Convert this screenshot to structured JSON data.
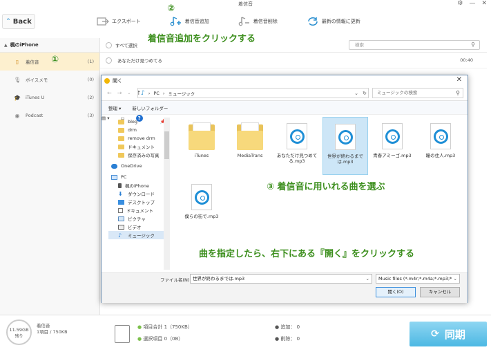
{
  "window": {
    "title": "着信音",
    "controls": [
      "⚙",
      "—",
      "✕"
    ]
  },
  "back_button": {
    "label": "Back"
  },
  "toolbar": {
    "export": "エクスポート",
    "add_ringtone": "着信音追加",
    "delete_ringtone": "着信音削除",
    "refresh": "最新の情報に更新"
  },
  "sidebar": {
    "device": "楓のiPhone",
    "items": [
      {
        "label": "着信音",
        "count": "(1)"
      },
      {
        "label": "ボイスメモ",
        "count": "(0)"
      },
      {
        "label": "iTunes U",
        "count": "(2)"
      },
      {
        "label": "Podcast",
        "count": "(3)"
      }
    ]
  },
  "list": {
    "select_all": "すべて選択",
    "search_placeholder": "検索",
    "rows": [
      {
        "title": "あなただけ見つめてる",
        "duration": "00:40"
      }
    ]
  },
  "dialog": {
    "title": "開く",
    "address": {
      "pc": "PC",
      "folder": "ミュージック"
    },
    "search_placeholder": "ミュージックの検索",
    "organize": "整理 ▾",
    "new_folder": "新しいフォルダー",
    "nav_items": [
      {
        "label": "blog",
        "icon": "folder"
      },
      {
        "label": "drm",
        "icon": "folder"
      },
      {
        "label": "remove drm",
        "icon": "folder"
      },
      {
        "label": "ドキュメント",
        "icon": "folder"
      },
      {
        "label": "保存済みの写真",
        "icon": "folder"
      },
      {
        "label": "OneDrive",
        "icon": "cloud"
      },
      {
        "label": "PC",
        "icon": "pc"
      },
      {
        "label": "楓のiPhone",
        "icon": "phone"
      },
      {
        "label": "ダウンロード",
        "icon": "download"
      },
      {
        "label": "デスクトップ",
        "icon": "desktop"
      },
      {
        "label": "ドキュメント",
        "icon": "doc"
      },
      {
        "label": "ピクチャ",
        "icon": "picture"
      },
      {
        "label": "ビデオ",
        "icon": "video"
      },
      {
        "label": "ミュージック",
        "icon": "music"
      }
    ],
    "files": [
      {
        "name": "iTunes",
        "type": "folder"
      },
      {
        "name": "MediaTrans",
        "type": "folder"
      },
      {
        "name": "あなただけ見つめてる.mp3",
        "type": "music"
      },
      {
        "name": "世界が終わるまでは.mp3",
        "type": "music"
      },
      {
        "name": "青春アミーゴ.mp3",
        "type": "music"
      },
      {
        "name": "瞳の住人.mp3",
        "type": "music"
      },
      {
        "name": "僕らの街で.mp3",
        "type": "music"
      }
    ],
    "filename_label": "ファイル名(N):",
    "filename_value": "世界が終わるまでは.mp3",
    "filetype_value": "Music files (*.m4r;*.m4a;*.mp3;*",
    "open_button": "開く(O)",
    "cancel_button": "キャンセル"
  },
  "footer": {
    "storage_size": "11.59GB",
    "storage_sub": "残り",
    "ringtone_label": "着信音",
    "ringtone_info": "1項目 / 750KB",
    "total_items": "項目合計 1（750KB）",
    "selected_items": "選択項目 0（0B）",
    "added": "追加： 0",
    "deleted": "削除： 0",
    "sync_button": "同期"
  },
  "annotations": {
    "step1": "①",
    "step2": "②",
    "step2_text": "着信音追加をクリックする",
    "step3_text": "③ 着信音に用いれる曲を選ぶ",
    "step4_text": "曲を指定したら、右下にある『開く』をクリックする"
  },
  "colors": {
    "accent": "#2a8fcf",
    "annotation": "#3d8f1e",
    "sidebar_active": "#fdf0cf",
    "sync_button": "#4cb8e3"
  }
}
